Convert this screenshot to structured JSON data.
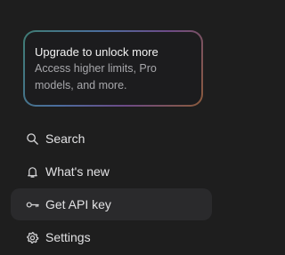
{
  "upgrade_card": {
    "title": "Upgrade to unlock more",
    "description": "Access higher limits, Pro models, and more."
  },
  "nav": {
    "items": [
      {
        "label": "Search",
        "icon": "search-icon"
      },
      {
        "label": "What's new",
        "icon": "bell-icon"
      },
      {
        "label": "Get API key",
        "icon": "key-icon",
        "active": true
      },
      {
        "label": "Settings",
        "icon": "gear-icon"
      }
    ]
  },
  "colors": {
    "background": "#1e1e1e",
    "active_item": "#2a2a2c",
    "text_primary": "#e2e2e4",
    "text_secondary": "#a7a7ab"
  }
}
